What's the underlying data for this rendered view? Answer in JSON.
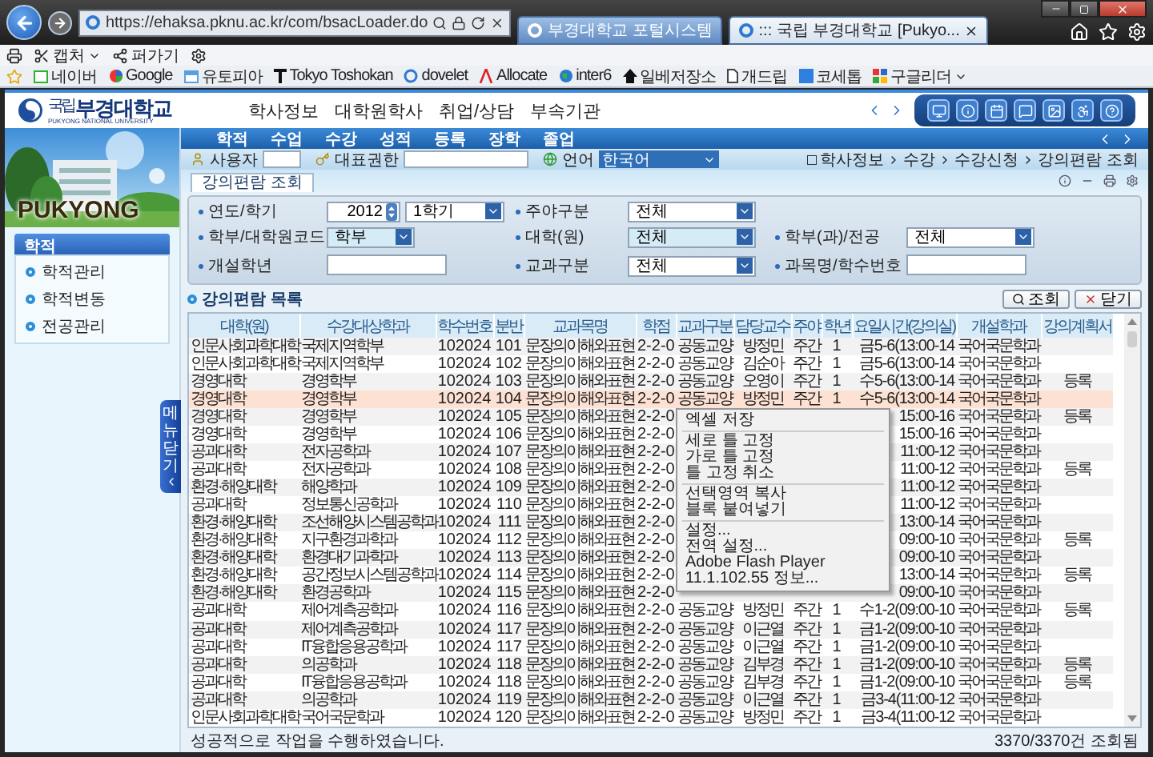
{
  "browser": {
    "url": "https://ehaksa.pknu.ac.kr/com/bsacLoader.do",
    "tabs": [
      {
        "title": "부경대학교 포털시스템",
        "selected": false
      },
      {
        "title": "::: 국립 부경대학교 [Pukyo...",
        "selected": true
      }
    ],
    "command_bar": [
      {
        "label": "캡처"
      },
      {
        "label": "퍼가기"
      }
    ],
    "favorites": [
      {
        "label": "네이버"
      },
      {
        "label": "Google"
      },
      {
        "label": "유토피아"
      },
      {
        "label": "Tokyo Toshokan"
      },
      {
        "label": "dovelet"
      },
      {
        "label": "Allocate"
      },
      {
        "label": "inter6"
      },
      {
        "label": "일베저장소"
      },
      {
        "label": "개드립"
      },
      {
        "label": "코세톱"
      },
      {
        "label": "구글리더"
      }
    ]
  },
  "site": {
    "logo_prefix": "국립",
    "logo": "부경대학교",
    "logo_english": "PUKYONG NATIONAL UNIVERSITY",
    "top_menu": [
      "학사정보",
      "대학원학사",
      "취업/상담",
      "부속기관"
    ],
    "main_menu": [
      "학적",
      "수업",
      "수강",
      "성적",
      "등록",
      "장학",
      "졸업"
    ]
  },
  "user_bar": {
    "user_label": "사용자",
    "role_label": "대표권한",
    "language_label": "언어",
    "language": "한국어",
    "breadcrumb": [
      "학사정보",
      "수강",
      "수강신청",
      "강의편람 조회"
    ]
  },
  "sidebar": {
    "banner": "PUKYONG",
    "section": "학적",
    "items": [
      "학적관리",
      "학적변동",
      "전공관리"
    ],
    "toggle": "메뉴닫기"
  },
  "page_tabs": [
    {
      "label": "강의편람 조회",
      "selected": true
    }
  ],
  "filter_rows": [
    [
      {
        "label": "연도/학기",
        "kind": "year_term",
        "value": "2012",
        "term": "1학기"
      },
      {
        "label": "주야구분",
        "kind": "select",
        "value": "전체",
        "highlighted": false
      }
    ],
    [
      {
        "label": "학부/대학원코드",
        "kind": "select",
        "value": "학부",
        "highlighted": true
      },
      {
        "label": "대학(원)",
        "kind": "select",
        "value": "전체",
        "highlighted": true
      },
      {
        "label": "학부(과)/전공",
        "kind": "select",
        "value": "전체",
        "highlighted": false
      }
    ],
    [
      {
        "label": "개설학년",
        "kind": "text"
      },
      {
        "label": "교과구분",
        "kind": "select",
        "value": "전체",
        "highlighted": false
      },
      {
        "label": "과목명/학수번호",
        "kind": "text"
      }
    ]
  ],
  "list": {
    "title": "강의편람 목록",
    "buttons": [
      {
        "label": "조회",
        "kind": "search"
      },
      {
        "label": "닫기",
        "kind": "close"
      }
    ],
    "columns": [
      "대학(원)",
      "수강대상학과",
      "학수번호",
      "분반",
      "교과목명",
      "학점",
      "교과구분",
      "담당교수",
      "주야",
      "학년",
      "요일시간(강의실)",
      "개설학과",
      "강의계획서"
    ],
    "rows": [
      {
        "selected": false,
        "cells": [
          "인문사회과학대학",
          "국제지역학부",
          "102024",
          "101",
          "문장의이해와표현",
          "2-2-0",
          "공동교양",
          "방정민",
          "주간",
          "1",
          "금5-6(13:00-14",
          "국어국문학과",
          null
        ]
      },
      {
        "selected": false,
        "cells": [
          "인문사회과학대학",
          "국제지역학부",
          "102024",
          "102",
          "문장의이해와표현",
          "2-2-0",
          "공동교양",
          "김순아",
          "주간",
          "1",
          "금5-6(13:00-14",
          "국어국문학과",
          null
        ]
      },
      {
        "selected": false,
        "cells": [
          "경영대학",
          "경영학부",
          "102024",
          "103",
          "문장의이해와표현",
          "2-2-0",
          "공동교양",
          "오영이",
          "주간",
          "1",
          "수5-6(13:00-14",
          "국어국문학과",
          "등록"
        ]
      },
      {
        "selected": true,
        "cells": [
          "경영대학",
          "경영학부",
          "102024",
          "104",
          "문장의이해와표현",
          "2-2-0",
          "공동교양",
          "방정민",
          "주간",
          "1",
          "수5-6(13:00-14",
          "국어국문학과",
          null
        ]
      },
      {
        "selected": false,
        "cells": [
          "경영대학",
          "경영학부",
          "102024",
          "105",
          "문장의이해와표현",
          "2-2-0",
          null,
          null,
          null,
          null,
          "15:00-16",
          "국어국문학과",
          "등록"
        ]
      },
      {
        "selected": false,
        "cells": [
          "경영대학",
          "경영학부",
          "102024",
          "106",
          "문장의이해와표현",
          "2-2-0",
          null,
          null,
          null,
          null,
          "15:00-16",
          "국어국문학과",
          null
        ]
      },
      {
        "selected": false,
        "cells": [
          "공과대학",
          "전자공학과",
          "102024",
          "107",
          "문장의이해와표현",
          "2-2-0",
          null,
          null,
          null,
          null,
          "11:00-12",
          "국어국문학과",
          null
        ]
      },
      {
        "selected": false,
        "cells": [
          "공과대학",
          "전자공학과",
          "102024",
          "108",
          "문장의이해와표현",
          "2-2-0",
          null,
          null,
          null,
          null,
          "11:00-12",
          "국어국문학과",
          "등록"
        ]
      },
      {
        "selected": false,
        "cells": [
          "환경·해양대학",
          "해양학과",
          "102024",
          "109",
          "문장의이해와표현",
          "2-2-0",
          null,
          null,
          null,
          null,
          "11:00-12",
          "국어국문학과",
          null
        ]
      },
      {
        "selected": false,
        "cells": [
          "공과대학",
          "정보통신공학과",
          "102024",
          "110",
          "문장의이해와표현",
          "2-2-0",
          null,
          null,
          null,
          null,
          "11:00-12",
          "국어국문학과",
          null
        ]
      },
      {
        "selected": false,
        "cells": [
          "환경·해양대학",
          "조선해양시스템공학과",
          "102024",
          "111",
          "문장의이해와표현",
          "2-2-0",
          null,
          null,
          null,
          null,
          "13:00-14",
          "국어국문학과",
          null
        ]
      },
      {
        "selected": false,
        "cells": [
          "환경·해양대학",
          "지구환경과학과",
          "102024",
          "112",
          "문장의이해와표현",
          "2-2-0",
          null,
          null,
          null,
          null,
          "09:00-10",
          "국어국문학과",
          "등록"
        ]
      },
      {
        "selected": false,
        "cells": [
          "환경·해양대학",
          "환경대기과학과",
          "102024",
          "113",
          "문장의이해와표현",
          "2-2-0",
          null,
          null,
          null,
          null,
          "09:00-10",
          "국어국문학과",
          null
        ]
      },
      {
        "selected": false,
        "cells": [
          "환경·해양대학",
          "공간정보시스템공학과",
          "102024",
          "114",
          "문장의이해와표현",
          "2-2-0",
          null,
          null,
          null,
          null,
          "13:00-14",
          "국어국문학과",
          "등록"
        ]
      },
      {
        "selected": false,
        "cells": [
          "환경·해양대학",
          "환경공학과",
          "102024",
          "115",
          "문장의이해와표현",
          "2-2-0",
          null,
          null,
          null,
          null,
          "09:00-10",
          "국어국문학과",
          null
        ]
      },
      {
        "selected": false,
        "cells": [
          "공과대학",
          "제어계측공학과",
          "102024",
          "116",
          "문장의이해와표현",
          "2-2-0",
          "공동교양",
          "방정민",
          "주간",
          "1",
          "수1-2(09:00-10",
          "국어국문학과",
          "등록"
        ]
      },
      {
        "selected": false,
        "cells": [
          "공과대학",
          "제어계측공학과",
          "102024",
          "117",
          "문장의이해와표현",
          "2-2-0",
          "공동교양",
          "이근열",
          "주간",
          "1",
          "금1-2(09:00-10",
          "국어국문학과",
          null
        ]
      },
      {
        "selected": false,
        "cells": [
          "공과대학",
          "IT융합응용공학과",
          "102024",
          "117",
          "문장의이해와표현",
          "2-2-0",
          "공동교양",
          "이근열",
          "주간",
          "1",
          "금1-2(09:00-10",
          "국어국문학과",
          null
        ]
      },
      {
        "selected": false,
        "cells": [
          "공과대학",
          "의공학과",
          "102024",
          "118",
          "문장의이해와표현",
          "2-2-0",
          "공동교양",
          "김부경",
          "주간",
          "1",
          "금1-2(09:00-10",
          "국어국문학과",
          "등록"
        ]
      },
      {
        "selected": false,
        "cells": [
          "공과대학",
          "IT융합응용공학과",
          "102024",
          "118",
          "문장의이해와표현",
          "2-2-0",
          "공동교양",
          "김부경",
          "주간",
          "1",
          "금1-2(09:00-10",
          "국어국문학과",
          "등록"
        ]
      },
      {
        "selected": false,
        "cells": [
          "공과대학",
          "의공학과",
          "102024",
          "119",
          "문장의이해와표현",
          "2-2-0",
          "공동교양",
          "이근열",
          "주간",
          "1",
          "금3-4(11:00-12",
          "국어국문학과",
          null
        ]
      },
      {
        "selected": false,
        "cells": [
          "인문사회과학대학",
          "국어국문학과",
          "102024",
          "120",
          "문장의이해와표현",
          "2-2-0",
          "공동교양",
          "방정민",
          "주간",
          "1",
          "금3-4(11:00-12",
          "국어국문학과",
          null
        ]
      }
    ],
    "context_menu": [
      [
        "엑셀 저장"
      ],
      [
        "세로 틀 고정",
        "가로 틀 고정",
        "틀 고정 취소"
      ],
      [
        "선택영역 복사",
        "블록 붙여넣기"
      ],
      [
        "설정...",
        "전역 설정...",
        "Adobe Flash Player 11.1.102.55 정보..."
      ]
    ]
  },
  "status_bar": {
    "message": "성공적으로 작업을 수행하였습니다.",
    "count": "3370/3370건 조회됨"
  }
}
